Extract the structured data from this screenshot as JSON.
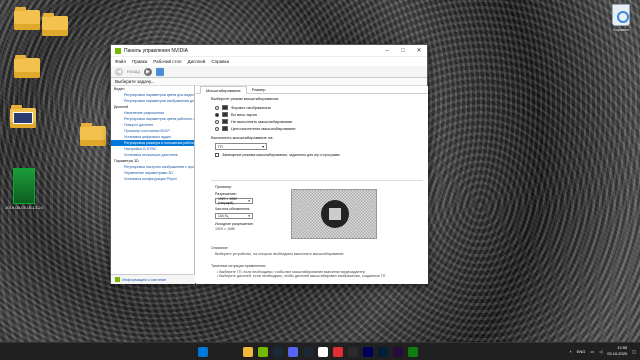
{
  "desktop": {
    "icons": [
      {
        "label": ""
      },
      {
        "label": ""
      },
      {
        "label": ""
      },
      {
        "label": ""
      },
      {
        "label": ""
      },
      {
        "label": "2019-08-03 16-13-24"
      }
    ],
    "recycle_bin_label": "Корзина"
  },
  "window": {
    "title": "Панель управления NVIDIA",
    "menu": [
      "Файл",
      "Правка",
      "Рабочий стол",
      "Дисплей",
      "Справка"
    ],
    "toolbar": {
      "back_label": "Назад",
      "forward_symbol": "▶"
    },
    "select_task_label": "Выберите задачу...",
    "tree": [
      {
        "text": "Видео",
        "kind": "cat"
      },
      {
        "text": "Регулировка параметров цвета для видео",
        "kind": "sub"
      },
      {
        "text": "Регулировка параметров изображения для видео",
        "kind": "sub"
      },
      {
        "text": "Дисплей",
        "kind": "cat"
      },
      {
        "text": "Изменение разрешения",
        "kind": "sub"
      },
      {
        "text": "Регулировка параметров цвета рабочего стола",
        "kind": "sub"
      },
      {
        "text": "Поворот дисплея",
        "kind": "sub"
      },
      {
        "text": "Просмотр состояния HDCP",
        "kind": "sub"
      },
      {
        "text": "Установка цифрового аудио",
        "kind": "sub"
      },
      {
        "text": "Регулировка размера и положения рабочего стола",
        "kind": "sub-sel"
      },
      {
        "text": "Настройка G-SYNC",
        "kind": "sub"
      },
      {
        "text": "Установка нескольких дисплеев",
        "kind": "sub"
      },
      {
        "text": "Параметры 3D",
        "kind": "cat"
      },
      {
        "text": "Регулировка настроек изображения с просмотром",
        "kind": "sub"
      },
      {
        "text": "Управление параметрами 3D",
        "kind": "sub"
      },
      {
        "text": "Установка конфигурации PhysX",
        "kind": "sub"
      }
    ],
    "system_info_link": "Информация о системе",
    "tabs": [
      "Масштабирование",
      "Размер"
    ],
    "scaling_mode_heading": "Выберите режим масштабирования:",
    "scaling_modes": [
      {
        "label": "Формат изображения",
        "selected": false
      },
      {
        "label": "Во весь экран",
        "selected": true
      },
      {
        "label": "Не выполнять масштабирование",
        "selected": false
      },
      {
        "label": "Целочисленное масштабирование",
        "selected": false
      }
    ],
    "perform_on_label": "Выполнить масштабирование на:",
    "perform_on_value": "ГП",
    "override_label": "Замещение режима масштабирования, заданного для игр и программ",
    "preview_heading": "Просмотр",
    "resolution_label": "Разрешение:",
    "resolution_value": "1920 × 1080 (текущий)",
    "refresh_label": "Частота обновления:",
    "refresh_value": "144 Гц",
    "source_res_label": "Исходное разрешение:",
    "source_res_value": "1920 × 1080",
    "description_heading": "Описание:",
    "description_text": "Выберите устройство, на котором необходимо выполнять масштабирование.",
    "usage_heading": "Типичные ситуации применения:",
    "usage_items": [
      "Выберите ГП, если необходимо, чтобы все масштабирование выполнял видеоадаптер",
      "Выберите дисплей, если необходимо, чтобы дисплей масштабировал изображения, созданные ГП"
    ]
  },
  "taskbar": {
    "lang": "ENG",
    "time": "13:55",
    "date": "03.10.2020",
    "icons": [
      "windows-icon",
      "search-icon",
      "task-view-icon",
      "explorer-icon",
      "nvidia-icon",
      "steam-icon",
      "discord-icon",
      "steam-2-icon",
      "yandex-icon",
      "lightroom-icon",
      "acrobat-icon",
      "audition-icon",
      "photoshop-icon",
      "premiere-icon",
      "xbox-icon"
    ],
    "colors": [
      "#0078d7",
      "#202020",
      "#202020",
      "#f0b93a",
      "#76b900",
      "#1b2838",
      "#5865f2",
      "#1b2838",
      "#ffffff",
      "#e03030",
      "#2a2a2a",
      "#00005b",
      "#001e36",
      "#2a0a3a",
      "#107c10"
    ]
  }
}
